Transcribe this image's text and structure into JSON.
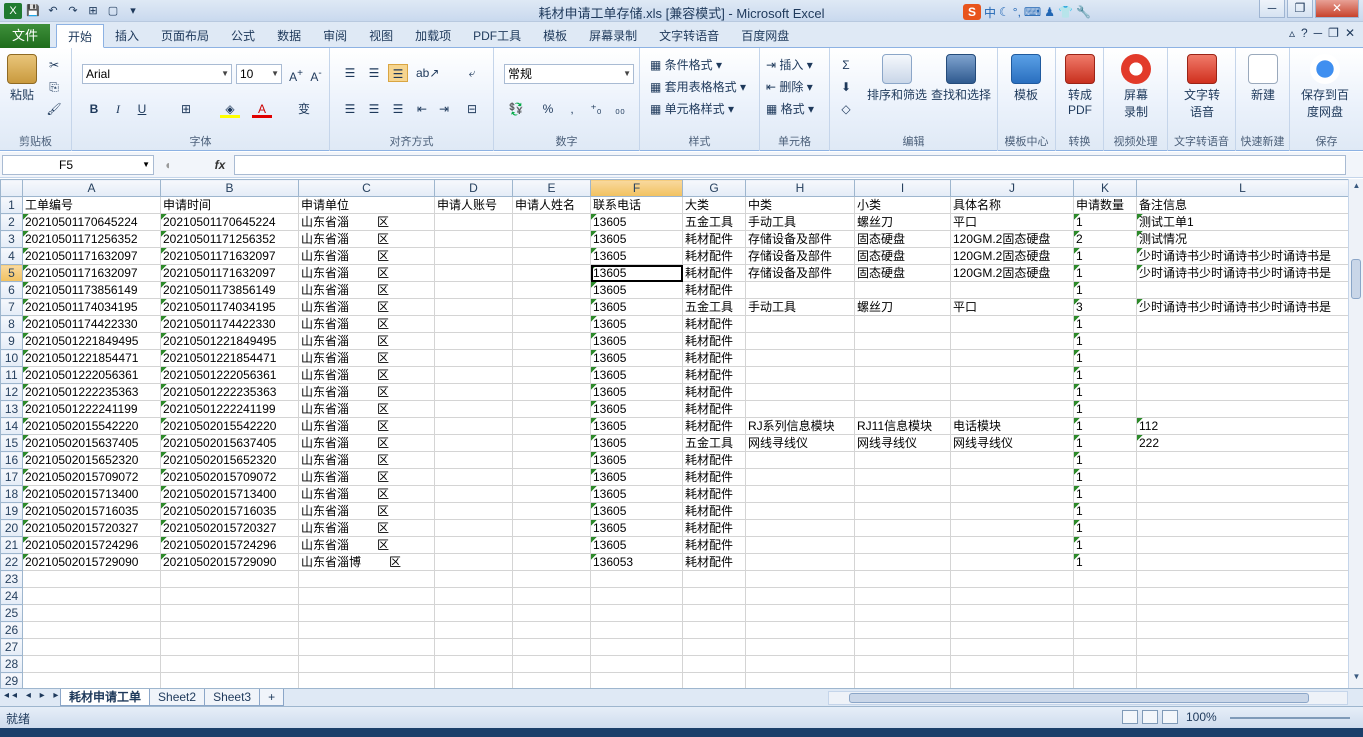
{
  "window": {
    "title": "耗材申请工单存储.xls  [兼容模式]  -  Microsoft Excel",
    "ime_logo": "S",
    "ime_lang": "中"
  },
  "ribbon_tabs": [
    "开始",
    "插入",
    "页面布局",
    "公式",
    "数据",
    "审阅",
    "视图",
    "加载项",
    "PDF工具",
    "模板",
    "屏幕录制",
    "文字转语音",
    "百度网盘"
  ],
  "file_tab": "文件",
  "active_tab": "开始",
  "ribbon": {
    "clipboard": {
      "label": "剪贴板",
      "paste": "粘贴"
    },
    "font": {
      "label": "字体",
      "name": "Arial",
      "size": "10",
      "bold": "B",
      "italic": "I",
      "underline": "U"
    },
    "alignment": {
      "label": "对齐方式"
    },
    "number": {
      "label": "数字",
      "format": "常规"
    },
    "styles": {
      "label": "样式",
      "conditional": "条件格式",
      "table": "套用表格格式",
      "cell": "单元格样式"
    },
    "cells": {
      "label": "单元格",
      "insert": "插入",
      "delete": "删除",
      "format": "格式"
    },
    "editing": {
      "label": "编辑",
      "sort": "排序和筛选",
      "find": "查找和选择"
    },
    "template": {
      "label": "模板中心",
      "btn": "模板"
    },
    "convert": {
      "label": "转换",
      "btn": "转成PDF"
    },
    "video": {
      "label": "视频处理",
      "btn": "屏幕录制"
    },
    "tts": {
      "label": "文字转语音",
      "btn": "文字转语音"
    },
    "quicknew": {
      "label": "快速新建",
      "btn": "新建"
    },
    "save": {
      "label": "保存",
      "btn": "保存到百度网盘"
    }
  },
  "formula_bar": {
    "name_box": "F5",
    "fx": "fx",
    "formula": ""
  },
  "columns": [
    "A",
    "B",
    "C",
    "D",
    "E",
    "F",
    "G",
    "H",
    "I",
    "J",
    "K",
    "L"
  ],
  "header_row": [
    "工单编号",
    "申请时间",
    "申请单位",
    "申请人账号",
    "申请人姓名",
    "联系电话",
    "大类",
    "中类",
    "小类",
    "具体名称",
    "申请数量",
    "备注信息"
  ],
  "rows": [
    [
      "20210501170645224",
      "20210501170645224",
      "山东省淄",
      "区",
      "",
      "13605",
      "五金工具",
      "手动工具",
      "螺丝刀",
      "平口",
      "1",
      "测试工单1"
    ],
    [
      "20210501171256352",
      "20210501171256352",
      "山东省淄",
      "区",
      "",
      "13605",
      "耗材配件",
      "存储设备及部件",
      "固态硬盘",
      "120GM.2固态硬盘",
      "2",
      "测试情况"
    ],
    [
      "20210501171632097",
      "20210501171632097",
      "山东省淄",
      "区",
      "",
      "13605",
      "耗材配件",
      "存储设备及部件",
      "固态硬盘",
      "120GM.2固态硬盘",
      "1",
      "少时诵诗书少时诵诗书少时诵诗书是"
    ],
    [
      "20210501171632097",
      "20210501171632097",
      "山东省淄",
      "区",
      "",
      "13605",
      "耗材配件",
      "存储设备及部件",
      "固态硬盘",
      "120GM.2固态硬盘",
      "1",
      "少时诵诗书少时诵诗书少时诵诗书是"
    ],
    [
      "20210501173856149",
      "20210501173856149",
      "山东省淄",
      "区",
      "",
      "13605",
      "耗材配件",
      "",
      "",
      "",
      "1",
      ""
    ],
    [
      "20210501174034195",
      "20210501174034195",
      "山东省淄",
      "区",
      "",
      "13605",
      "五金工具",
      "手动工具",
      "螺丝刀",
      "平口",
      "3",
      "少时诵诗书少时诵诗书少时诵诗书是"
    ],
    [
      "20210501174422330",
      "20210501174422330",
      "山东省淄",
      "区",
      "",
      "13605",
      "耗材配件",
      "",
      "",
      "",
      "1",
      ""
    ],
    [
      "20210501221849495",
      "20210501221849495",
      "山东省淄",
      "区",
      "",
      "13605",
      "耗材配件",
      "",
      "",
      "",
      "1",
      ""
    ],
    [
      "20210501221854471",
      "20210501221854471",
      "山东省淄",
      "区",
      "",
      "13605",
      "耗材配件",
      "",
      "",
      "",
      "1",
      ""
    ],
    [
      "20210501222056361",
      "20210501222056361",
      "山东省淄",
      "区",
      "",
      "13605",
      "耗材配件",
      "",
      "",
      "",
      "1",
      ""
    ],
    [
      "20210501222235363",
      "20210501222235363",
      "山东省淄",
      "区",
      "",
      "13605",
      "耗材配件",
      "",
      "",
      "",
      "1",
      ""
    ],
    [
      "20210501222241199",
      "20210501222241199",
      "山东省淄",
      "区",
      "",
      "13605",
      "耗材配件",
      "",
      "",
      "",
      "1",
      ""
    ],
    [
      "20210502015542220",
      "20210502015542220",
      "山东省淄",
      "区",
      "",
      "13605",
      "耗材配件",
      "RJ系列信息模块",
      "RJ11信息模块",
      "电话模块",
      "1",
      "112"
    ],
    [
      "20210502015637405",
      "20210502015637405",
      "山东省淄",
      "区",
      "",
      "13605",
      "五金工具",
      "网线寻线仪",
      "网线寻线仪",
      "网线寻线仪",
      "1",
      "222"
    ],
    [
      "20210502015652320",
      "20210502015652320",
      "山东省淄",
      "区",
      "",
      "13605",
      "耗材配件",
      "",
      "",
      "",
      "1",
      ""
    ],
    [
      "20210502015709072",
      "20210502015709072",
      "山东省淄",
      "区",
      "",
      "13605",
      "耗材配件",
      "",
      "",
      "",
      "1",
      ""
    ],
    [
      "20210502015713400",
      "20210502015713400",
      "山东省淄",
      "区",
      "",
      "13605",
      "耗材配件",
      "",
      "",
      "",
      "1",
      ""
    ],
    [
      "20210502015716035",
      "20210502015716035",
      "山东省淄",
      "区",
      "",
      "13605",
      "耗材配件",
      "",
      "",
      "",
      "1",
      ""
    ],
    [
      "20210502015720327",
      "20210502015720327",
      "山东省淄",
      "区",
      "",
      "13605",
      "耗材配件",
      "",
      "",
      "",
      "1",
      ""
    ],
    [
      "20210502015724296",
      "20210502015724296",
      "山东省淄",
      "区",
      "",
      "13605",
      "耗材配件",
      "",
      "",
      "",
      "1",
      ""
    ],
    [
      "20210502015729090",
      "20210502015729090",
      "山东省淄博",
      "区",
      "",
      "136053",
      "耗材配件",
      "",
      "",
      "",
      "1",
      ""
    ]
  ],
  "sheets": [
    "耗材申请工单",
    "Sheet2",
    "Sheet3"
  ],
  "status": {
    "ready": "就绪",
    "zoom": "100%"
  }
}
